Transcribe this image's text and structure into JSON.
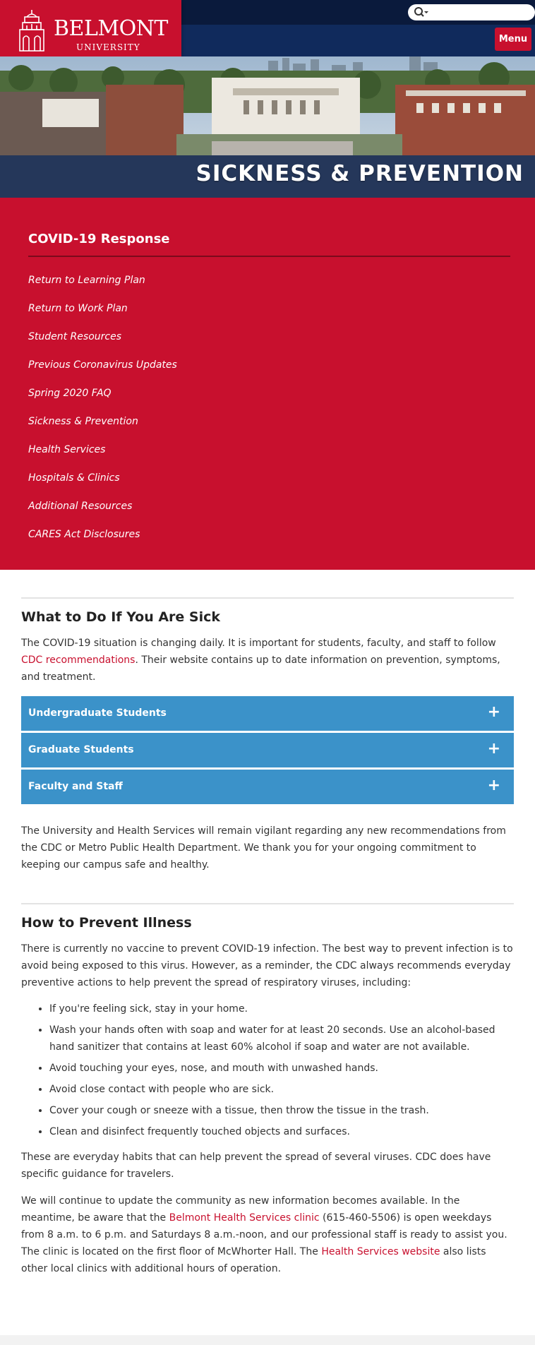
{
  "header": {
    "logo_name": "BELMONT",
    "logo_sub": "UNIVERSITY",
    "search_placeholder": "",
    "menu_label": "Menu"
  },
  "hero": {
    "title": "SICKNESS & PREVENTION"
  },
  "sidebar": {
    "heading": "COVID-19 Response",
    "items": [
      {
        "label": "Return to Learning Plan"
      },
      {
        "label": "Return to Work Plan"
      },
      {
        "label": "Student Resources"
      },
      {
        "label": "Previous Coronavirus Updates"
      },
      {
        "label": "Spring 2020 FAQ"
      },
      {
        "label": "Sickness & Prevention"
      },
      {
        "label": "Health Services"
      },
      {
        "label": "Hospitals & Clinics"
      },
      {
        "label": "Additional Resources"
      },
      {
        "label": "CARES Act Disclosures"
      }
    ]
  },
  "sick": {
    "heading": "What to Do If You Are Sick",
    "intro_before": "The COVID-19 situation is changing daily. It is important for students, faculty, and staff to follow ",
    "intro_link": "CDC recommendations",
    "intro_after": ". Their website contains up to date information on prevention, symptoms, and treatment.",
    "accordion": [
      {
        "label": "Undergraduate Students",
        "icon": "+"
      },
      {
        "label": "Graduate Students",
        "icon": "+"
      },
      {
        "label": "Faculty and Staff",
        "icon": "+"
      }
    ],
    "closing": "The University and Health Services will remain vigilant regarding any new recommendations from the CDC or Metro Public Health Department. We thank you for your ongoing commitment to keeping our campus safe and healthy."
  },
  "prevent": {
    "heading": "How to Prevent Illness",
    "intro": "There is currently no vaccine to prevent COVID-19 infection. The best way to prevent infection is to avoid being exposed to this virus. However, as a reminder, the CDC always recommends everyday preventive actions to help prevent the spread of respiratory viruses, including:",
    "bullets": [
      "If you're feeling sick, stay in your home.",
      "Wash your hands often with soap and water for at least 20 seconds. Use an alcohol-based hand sanitizer that contains at least 60% alcohol if soap and water are not available.",
      "Avoid touching your eyes, nose, and mouth with unwashed hands.",
      "Avoid close contact with people who are sick.",
      "Cover your cough or sneeze with a tissue, then throw the tissue in the trash.",
      "Clean and disinfect frequently touched objects and surfaces."
    ],
    "habits": "These are everyday habits that can help prevent the spread of several viruses. CDC does have specific guidance for travelers.",
    "update_p1": "We will continue to update the community as new information becomes available. In the meantime, be aware that the ",
    "update_link1": "Belmont Health Services clinic",
    "update_p2": " (615-460-5506) is open weekdays from 8 a.m. to 6 p.m. and Saturdays 8 a.m.-noon, and our professional staff is ready to assist you. The clinic is located on the first floor of McWhorter Hall. The ",
    "update_link2": "Health Services website",
    "update_p3": " also lists other local clinics with additional hours of operation."
  },
  "colors": {
    "brand_red": "#c8102e",
    "navy": "#102a5c",
    "accordion_blue": "#3b92c9",
    "link": "#c8102e"
  }
}
